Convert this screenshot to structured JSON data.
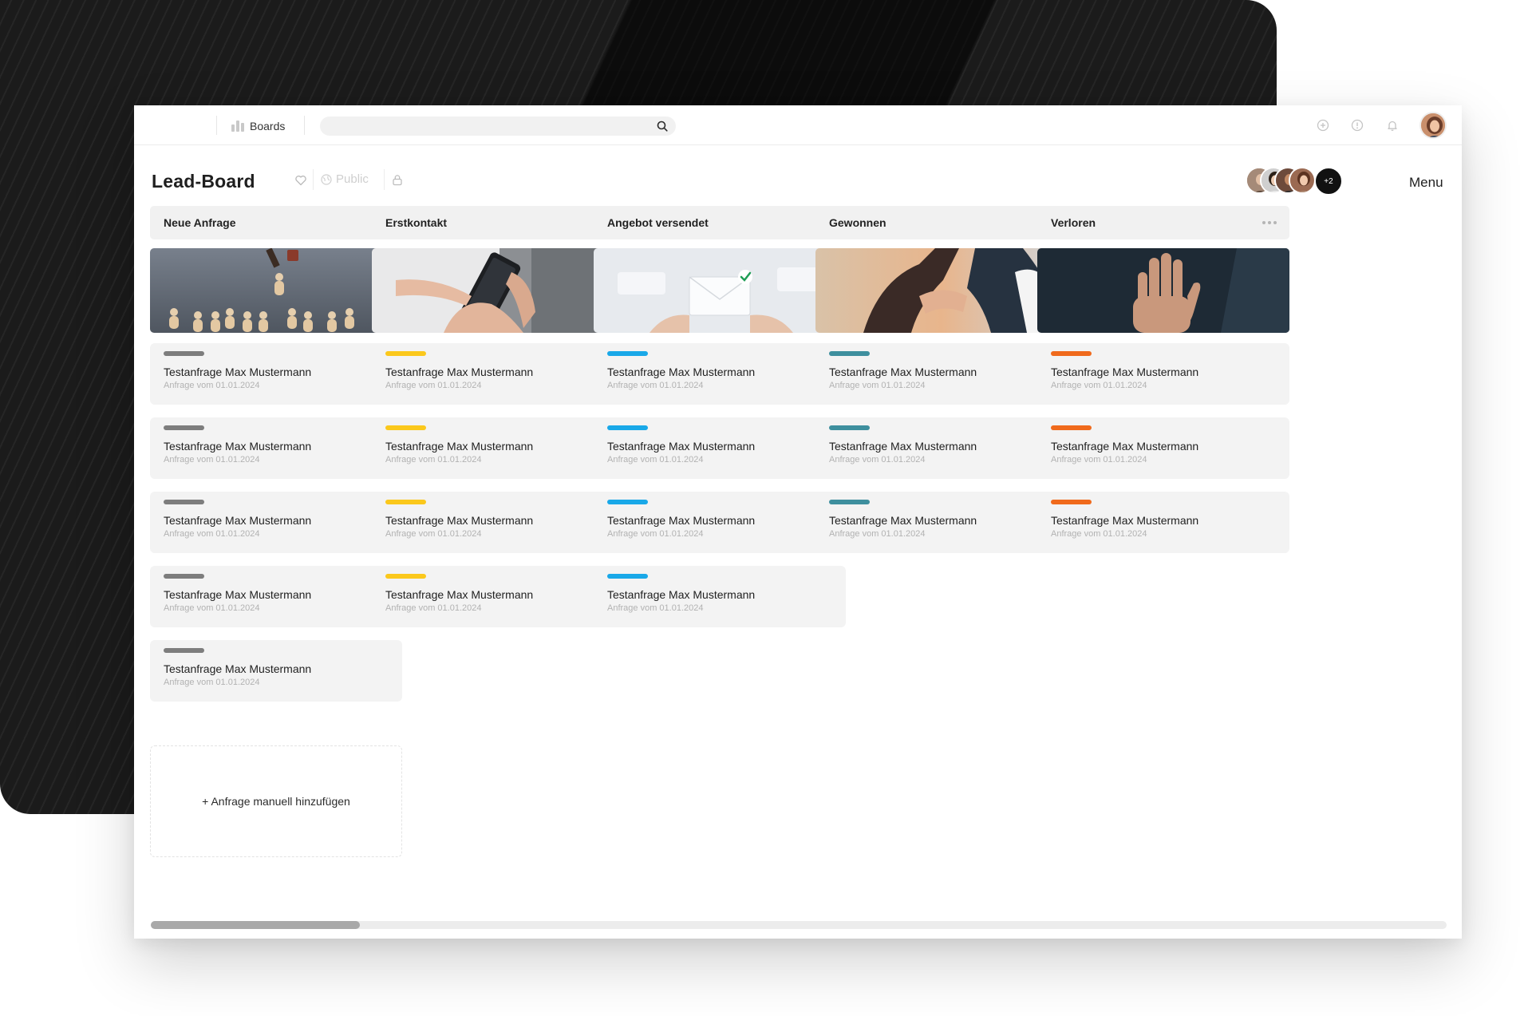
{
  "topbar": {
    "nav_label": "Boards",
    "search_placeholder": ""
  },
  "header": {
    "title": "Lead-Board",
    "visibility": "Public",
    "members_more": "+2",
    "menu_label": "Menu"
  },
  "columns": [
    {
      "title": "Neue Anfrage",
      "tag_color": "#7d7d7d",
      "image": "wooden-figures",
      "cards": [
        {
          "title": "Testanfrage Max Mustermann",
          "subtitle": "Anfrage vom 01.01.2024"
        },
        {
          "title": "Testanfrage Max Mustermann",
          "subtitle": "Anfrage vom 01.01.2024"
        },
        {
          "title": "Testanfrage Max Mustermann",
          "subtitle": "Anfrage vom 01.01.2024"
        },
        {
          "title": "Testanfrage Max Mustermann",
          "subtitle": "Anfrage vom 01.01.2024"
        },
        {
          "title": "Testanfrage Max Mustermann",
          "subtitle": "Anfrage vom 01.01.2024"
        }
      ]
    },
    {
      "title": "Erstkontakt",
      "tag_color": "#fbc81c",
      "image": "smartphone-hands",
      "cards": [
        {
          "title": "Testanfrage Max Mustermann",
          "subtitle": "Anfrage vom 01.01.2024"
        },
        {
          "title": "Testanfrage Max Mustermann",
          "subtitle": "Anfrage vom 01.01.2024"
        },
        {
          "title": "Testanfrage Max Mustermann",
          "subtitle": "Anfrage vom 01.01.2024"
        },
        {
          "title": "Testanfrage Max Mustermann",
          "subtitle": "Anfrage vom 01.01.2024"
        }
      ]
    },
    {
      "title": "Angebot versendet",
      "tag_color": "#19a8e8",
      "image": "envelope-check",
      "cards": [
        {
          "title": "Testanfrage Max Mustermann",
          "subtitle": "Anfrage vom 01.01.2024"
        },
        {
          "title": "Testanfrage Max Mustermann",
          "subtitle": "Anfrage vom 01.01.2024"
        },
        {
          "title": "Testanfrage Max Mustermann",
          "subtitle": "Anfrage vom 01.01.2024"
        },
        {
          "title": "Testanfrage Max Mustermann",
          "subtitle": "Anfrage vom 01.01.2024"
        }
      ]
    },
    {
      "title": "Gewonnen",
      "tag_color": "#3e8f9e",
      "image": "handshake",
      "cards": [
        {
          "title": "Testanfrage Max Mustermann",
          "subtitle": "Anfrage vom 01.01.2024"
        },
        {
          "title": "Testanfrage Max Mustermann",
          "subtitle": "Anfrage vom 01.01.2024"
        },
        {
          "title": "Testanfrage Max Mustermann",
          "subtitle": "Anfrage vom 01.01.2024"
        }
      ]
    },
    {
      "title": "Verloren",
      "tag_color": "#f06a1c",
      "image": "stop-hand",
      "cards": [
        {
          "title": "Testanfrage Max Mustermann",
          "subtitle": "Anfrage vom 01.01.2024"
        },
        {
          "title": "Testanfrage Max Mustermann",
          "subtitle": "Anfrage vom 01.01.2024"
        },
        {
          "title": "Testanfrage Max Mustermann",
          "subtitle": "Anfrage vom 01.01.2024"
        }
      ]
    }
  ],
  "add_card_label": "+ Anfrage manuell hinzufügen",
  "horizontal_scroll_position": 0.0
}
